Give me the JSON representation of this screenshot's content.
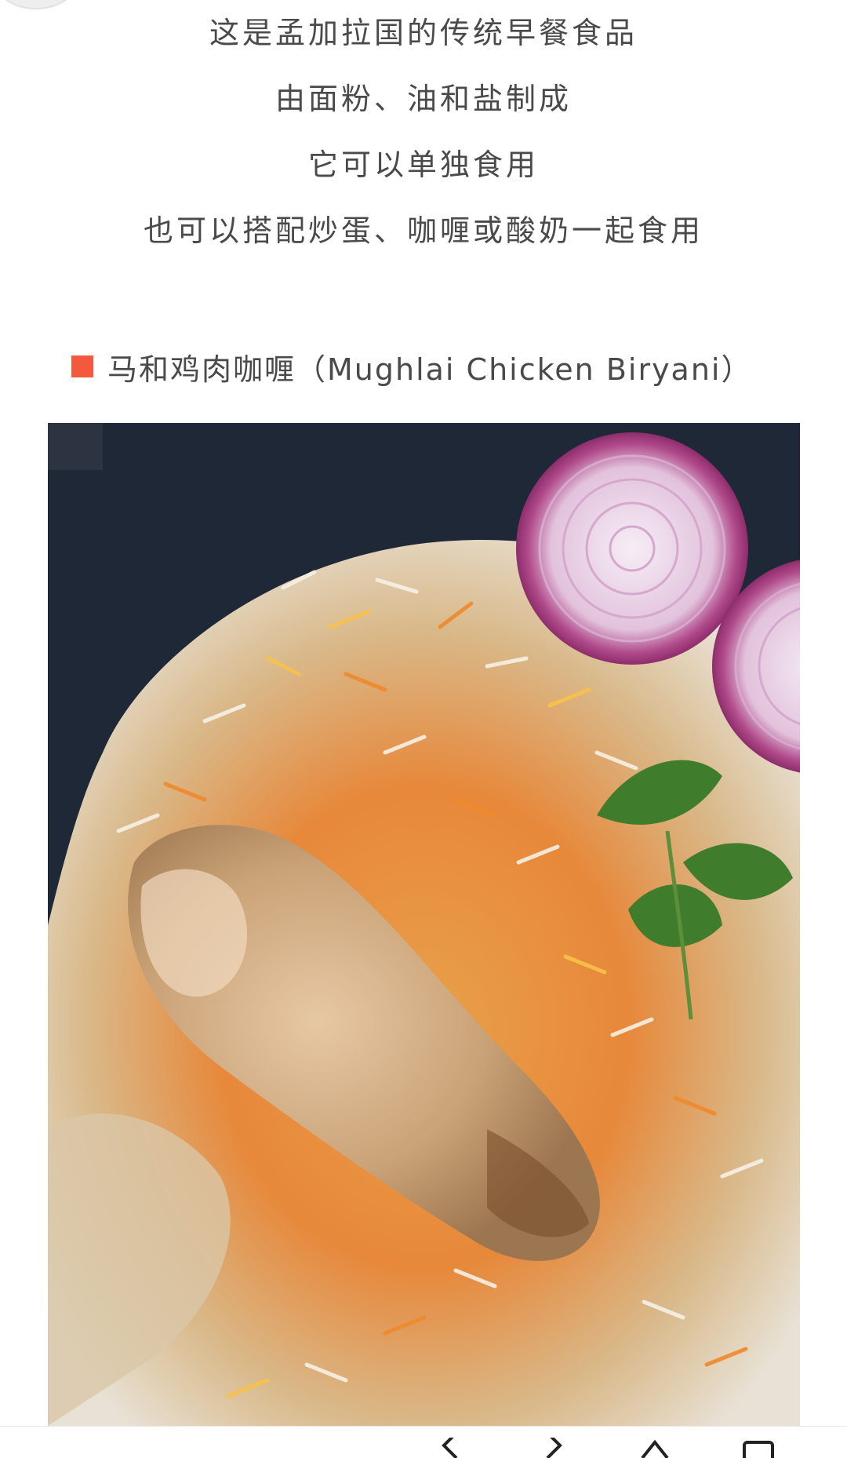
{
  "article": {
    "intro_lines": [
      "这是孟加拉国的传统早餐食品",
      "由面粉、油和盐制成",
      "它可以单独食用",
      "也可以搭配炒蛋、咖喱或酸奶一起食用"
    ],
    "section_heading": "马和鸡肉咖喱（Mughlai Chicken Biryani）",
    "accent_color": "#f4583d"
  },
  "icons": {
    "section_marker": "square-marker-icon",
    "bottom_bar": [
      "back-arrow-icon",
      "forward-arrow-icon",
      "home-icon",
      "tabs-icon"
    ]
  }
}
